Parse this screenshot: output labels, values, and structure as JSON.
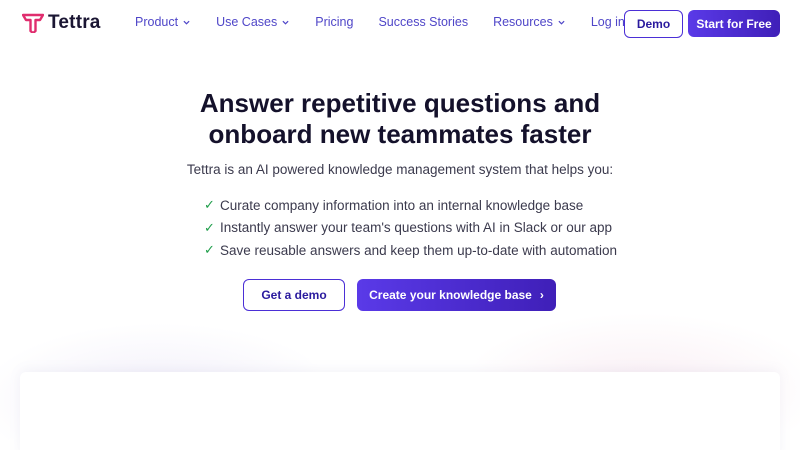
{
  "brand": {
    "name": "Tettra",
    "accent": "#4f46c8",
    "primary_button": "#4b2fd6",
    "logo_color": "#e02d6e",
    "check_color": "#1f9e4a"
  },
  "nav": {
    "items": [
      {
        "label": "Product",
        "dropdown": true
      },
      {
        "label": "Use Cases",
        "dropdown": true
      },
      {
        "label": "Pricing",
        "dropdown": false
      },
      {
        "label": "Success Stories",
        "dropdown": false
      },
      {
        "label": "Resources",
        "dropdown": true
      },
      {
        "label": "Log in",
        "dropdown": false
      }
    ],
    "demo_label": "Demo",
    "start_label": "Start for Free"
  },
  "hero": {
    "title_line1": "Answer repetitive questions and",
    "title_line2": "onboard new teammates faster",
    "subtitle": "Tettra is an AI powered knowledge management system that helps you:",
    "features": [
      "Curate company information into an internal knowledge base",
      "Instantly answer your team's questions with AI in Slack or our app",
      "Save reusable answers and keep them up-to-date with automation"
    ],
    "check_icon": "✓",
    "get_demo_label": "Get a demo",
    "create_label": "Create your knowledge base",
    "create_arrow": "›"
  }
}
